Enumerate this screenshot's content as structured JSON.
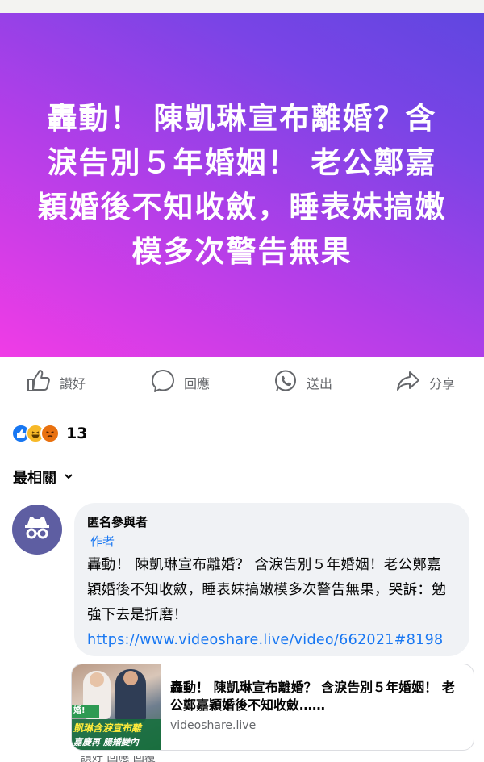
{
  "post": {
    "hero_text": "轟動！ 陳凱琳宣布離婚？含淚告別５年婚姻！ 老公鄭嘉穎婚後不知收斂，睡表妹搞嫩模多次警告無果",
    "gradient_colors": [
      "#f03ce6",
      "#5f46e0"
    ]
  },
  "actions": {
    "like": "讚好",
    "comment": "回應",
    "send": "送出",
    "share": "分享"
  },
  "reactions": {
    "icons": [
      "like-icon",
      "haha-icon",
      "angry-icon"
    ],
    "count": "13"
  },
  "sort": {
    "label": "最相關"
  },
  "comment": {
    "author": "匿名參與者",
    "author_tag": "作者",
    "text": "轟動！ 陳凱琳宣布離婚？ 含淚告別５年婚姻！老公鄭嘉穎婚後不知收斂，睡表妹搞嫩模多次警告無果，哭訴：勉強下去是折磨！ ",
    "link": "https://www.videoshare.live/video/662021#8198"
  },
  "link_card": {
    "title": "轟動！ 陳凱琳宣布離婚？ 含淚告別５年婚姻！ 老公鄭嘉穎婚後不知收斂……",
    "domain": "videoshare.live",
    "thumb_tag": "婚!",
    "thumb_line1": "凱琳含淚宣布離",
    "thumb_line2": "嘉慶再 腸婚變內"
  },
  "footer_partial": "讚好  回應  回覆"
}
